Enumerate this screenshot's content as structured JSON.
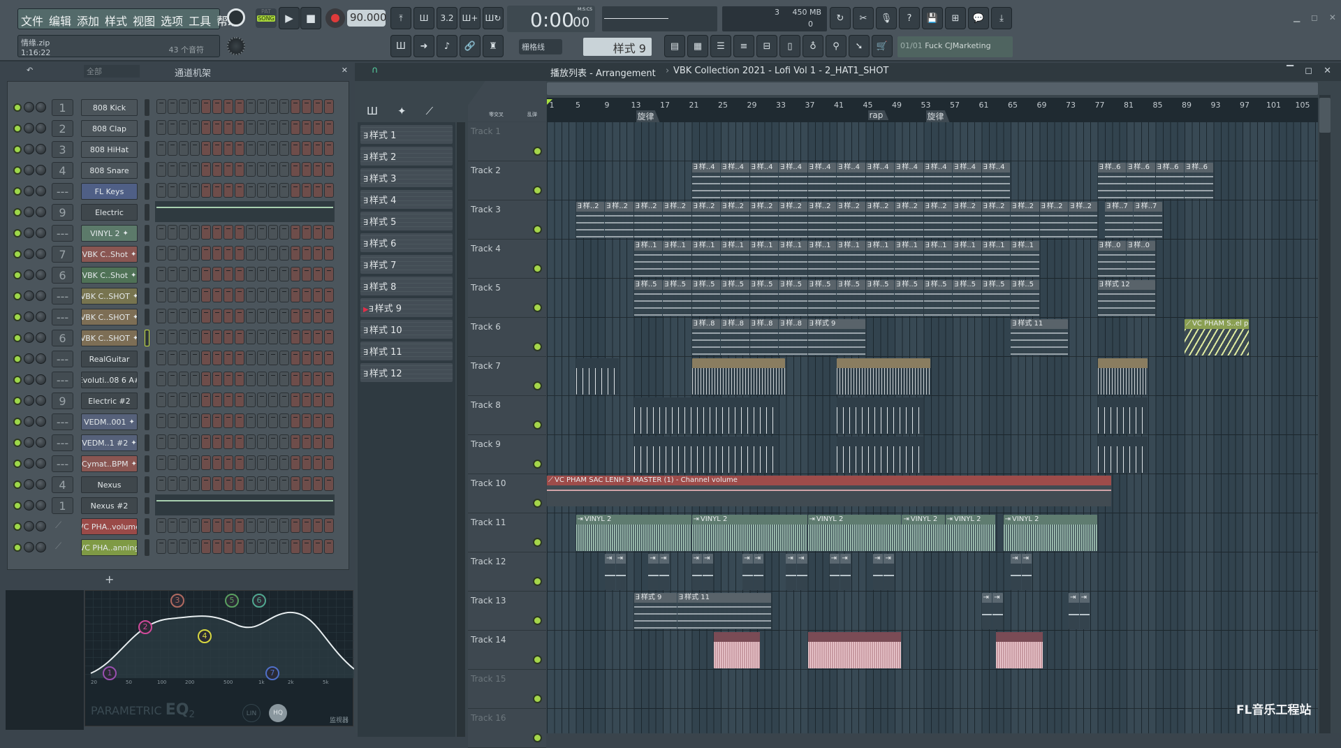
{
  "menu": [
    "文件",
    "编辑",
    "添加",
    "样式",
    "视图",
    "选项",
    "工具",
    "帮助"
  ],
  "transport": {
    "pat": "PAT",
    "song": "SONG",
    "tempo": "90.000",
    "time": "0:00:00",
    "time_main": "0:00",
    "time_cs": "00",
    "time_format": "M:S:CS",
    "cpu": "3",
    "memory": "450 MB",
    "polyphony": "0"
  },
  "hint": {
    "file": "情缘.zip",
    "duration": "1:16:22",
    "notes": "43 个音符"
  },
  "snap": "栅格线",
  "pattern_selector": "样式 9",
  "news": {
    "counter": "01/01",
    "text": "Fuck CJMarketing"
  },
  "channel_rack": {
    "filter": "全部",
    "title": "通道机架",
    "add": "+",
    "channels": [
      {
        "num": "1",
        "name": "808 Kick",
        "color": "#4b545a",
        "mode": "steps"
      },
      {
        "num": "2",
        "name": "808 Clap",
        "color": "#4b545a",
        "mode": "steps"
      },
      {
        "num": "3",
        "name": "808 HiHat",
        "color": "#4b545a",
        "mode": "steps"
      },
      {
        "num": "4",
        "name": "808 Snare",
        "color": "#4b545a",
        "mode": "steps"
      },
      {
        "num": "---",
        "name": "FL Keys",
        "color": "#4f5f86",
        "mode": "steps"
      },
      {
        "num": "9",
        "name": "Electric",
        "color": "#3f474c",
        "mode": "graph"
      },
      {
        "num": "---",
        "name": "VINYL 2",
        "color": "#5c7a6a",
        "mode": "steps",
        "audio": true
      },
      {
        "num": "7",
        "name": "VBK C..Shot",
        "color": "#8a5652",
        "mode": "steps",
        "audio": true
      },
      {
        "num": "6",
        "name": "VBK C..Shot",
        "color": "#4f7256",
        "mode": "steps",
        "audio": true
      },
      {
        "num": "---",
        "name": "VBK C..SHOT",
        "color": "#77744f",
        "mode": "steps",
        "audio": true
      },
      {
        "num": "---",
        "name": "VBK C..SHOT",
        "color": "#7d6e55",
        "mode": "steps",
        "audio": true
      },
      {
        "num": "6",
        "name": "VBK C..SHOT",
        "color": "#7d6e55",
        "mode": "steps",
        "audio": true,
        "selected": true
      },
      {
        "num": "---",
        "name": "RealGuitar",
        "color": "#3f474c",
        "mode": "steps"
      },
      {
        "num": "---",
        "name": "Evoluti..08 6 A#",
        "color": "#3f474c",
        "mode": "steps"
      },
      {
        "num": "9",
        "name": "Electric #2",
        "color": "#3f474c",
        "mode": "steps"
      },
      {
        "num": "---",
        "name": "VEDM..001",
        "color": "#56617a",
        "mode": "steps",
        "audio": true
      },
      {
        "num": "---",
        "name": "VEDM..1 #2",
        "color": "#56617a",
        "mode": "steps",
        "audio": true
      },
      {
        "num": "---",
        "name": "Cymat..BPM",
        "color": "#8a5652",
        "mode": "steps",
        "audio": true
      },
      {
        "num": "4",
        "name": "Nexus",
        "color": "#3f474c",
        "mode": "steps"
      },
      {
        "num": "1",
        "name": "Nexus #2",
        "color": "#3f474c",
        "mode": "graph"
      },
      {
        "num": "",
        "name": "VC PHA..volume",
        "color": "#9a4a48",
        "mode": "steps",
        "automation": true
      },
      {
        "num": "",
        "name": "VC PHA..anning",
        "color": "#7f9a45",
        "mode": "steps",
        "automation": true
      }
    ]
  },
  "eq": {
    "title": "PARAMETRIC",
    "title_big": "EQ",
    "title_sub": "2",
    "freqs": [
      "20",
      "50",
      "100",
      "200",
      "500",
      "1k",
      "2k",
      "5k"
    ],
    "bands": [
      "1",
      "2",
      "3",
      "4",
      "5",
      "6",
      "7"
    ],
    "band_colors": [
      "#9a4fb0",
      "#d04a9a",
      "#b06a60",
      "#d8d840",
      "#5aa060",
      "#50a890",
      "#4f70c8"
    ],
    "lin": "LIN",
    "hq": "HQ",
    "monitor": "监视器"
  },
  "playlist": {
    "title": "播放列表 - Arrangement",
    "breadcrumb": "VBK Collection 2021 - Lofi Vol 1 - 2_HAT1_SHOT",
    "toggle1": "零交叉",
    "toggle2": "乱弹",
    "patterns": [
      "样式 1",
      "样式 2",
      "样式 3",
      "样式 4",
      "样式 5",
      "样式 6",
      "样式 7",
      "样式 8",
      "样式 9",
      "样式 10",
      "样式 11",
      "样式 12"
    ],
    "current_pattern_index": 8,
    "bar_labels": [
      "1",
      "5",
      "9",
      "13",
      "17",
      "21",
      "25",
      "29",
      "33",
      "37",
      "41",
      "45",
      "49",
      "53",
      "57",
      "61",
      "65",
      "69",
      "73",
      "77",
      "81",
      "85",
      "89",
      "93",
      "97",
      "101",
      "105"
    ],
    "markers": [
      {
        "bar": 13,
        "label": "旋律"
      },
      {
        "bar": 45,
        "label": "rap"
      },
      {
        "bar": 53,
        "label": "旋律"
      }
    ],
    "tracks": [
      "Track 1",
      "Track 2",
      "Track 3",
      "Track 4",
      "Track 5",
      "Track 6",
      "Track 7",
      "Track 8",
      "Track 9",
      "Track 10",
      "Track 11",
      "Track 12",
      "Track 13",
      "Track 14",
      "Track 15",
      "Track 16"
    ],
    "clips": [
      {
        "track": 2,
        "start": 21,
        "len": 4,
        "repeat": 11,
        "label": "样..4",
        "type": "pattern"
      },
      {
        "track": 2,
        "start": 77,
        "len": 4,
        "repeat": 4,
        "label": "样..6",
        "type": "pattern"
      },
      {
        "track": 3,
        "start": 5,
        "len": 4,
        "repeat": 18,
        "label": "样..2",
        "type": "pattern"
      },
      {
        "track": 3,
        "start": 78,
        "len": 4,
        "repeat": 2,
        "label": "样..7",
        "type": "pattern"
      },
      {
        "track": 4,
        "start": 13,
        "len": 4,
        "repeat": 14,
        "label": "样..1",
        "type": "pattern"
      },
      {
        "track": 4,
        "start": 77,
        "len": 4,
        "repeat": 2,
        "label": "样..0",
        "type": "pattern"
      },
      {
        "track": 5,
        "start": 13,
        "len": 4,
        "repeat": 14,
        "label": "样..5",
        "type": "pattern"
      },
      {
        "track": 5,
        "start": 77,
        "len": 8,
        "repeat": 1,
        "label": "样式 12",
        "type": "pattern"
      },
      {
        "track": 6,
        "start": 21,
        "len": 4,
        "repeat": 4,
        "label": "样..8",
        "type": "pattern"
      },
      {
        "track": 6,
        "start": 37,
        "len": 8,
        "repeat": 1,
        "label": "样式 9",
        "type": "pattern"
      },
      {
        "track": 6,
        "start": 65,
        "len": 8,
        "repeat": 1,
        "label": "样式 11",
        "type": "pattern"
      },
      {
        "track": 6,
        "start": 89,
        "len": 9,
        "repeat": 1,
        "label": "VC PHAM S..el panning",
        "type": "auto-green"
      },
      {
        "track": 7,
        "start": 5,
        "len": 6,
        "repeat": 1,
        "label": "",
        "type": "hits"
      },
      {
        "track": 7,
        "start": 21,
        "len": 13,
        "repeat": 1,
        "label": "",
        "type": "tan"
      },
      {
        "track": 7,
        "start": 41,
        "len": 13,
        "repeat": 1,
        "label": "",
        "type": "tan"
      },
      {
        "track": 7,
        "start": 77,
        "len": 7,
        "repeat": 1,
        "label": "",
        "type": "tan"
      },
      {
        "track": 8,
        "start": 13,
        "len": 20,
        "repeat": 1,
        "label": "",
        "type": "hits"
      },
      {
        "track": 8,
        "start": 41,
        "len": 12,
        "repeat": 1,
        "label": "",
        "type": "hits"
      },
      {
        "track": 8,
        "start": 77,
        "len": 7,
        "repeat": 1,
        "label": "",
        "type": "hits"
      },
      {
        "track": 9,
        "start": 13,
        "len": 20,
        "repeat": 1,
        "label": "",
        "type": "hits"
      },
      {
        "track": 9,
        "start": 41,
        "len": 12,
        "repeat": 1,
        "label": "",
        "type": "hits"
      },
      {
        "track": 9,
        "start": 77,
        "len": 7,
        "repeat": 1,
        "label": "",
        "type": "hits"
      },
      {
        "track": 10,
        "start": 1,
        "len": 78,
        "repeat": 1,
        "label": "VC PHAM SAC LENH 3 MASTER (1) - Channel volume",
        "type": "auto-red"
      },
      {
        "track": 11,
        "start": 5,
        "len": 16,
        "repeat": 1,
        "label": "VINYL 2",
        "type": "vinyl"
      },
      {
        "track": 11,
        "start": 21,
        "len": 16,
        "repeat": 1,
        "label": "VINYL 2",
        "type": "vinyl"
      },
      {
        "track": 11,
        "start": 37,
        "len": 13,
        "repeat": 1,
        "label": "VINYL 2",
        "type": "vinyl"
      },
      {
        "track": 11,
        "start": 50,
        "len": 6,
        "repeat": 1,
        "label": "VINYL 2",
        "type": "vinyl"
      },
      {
        "track": 11,
        "start": 56,
        "len": 7,
        "repeat": 1,
        "label": "VINYL 2",
        "type": "vinyl"
      },
      {
        "track": 11,
        "start": 64,
        "len": 13,
        "repeat": 1,
        "label": "VINYL 2",
        "type": "vinyl"
      },
      {
        "track": 12,
        "start": 9,
        "len": 1.5,
        "repeat": 2,
        "label": "",
        "type": "fx"
      },
      {
        "track": 12,
        "start": 15,
        "len": 1.5,
        "repeat": 2,
        "label": "",
        "type": "fx"
      },
      {
        "track": 12,
        "start": 21,
        "len": 1.5,
        "repeat": 2,
        "label": "",
        "type": "fx"
      },
      {
        "track": 12,
        "start": 28,
        "len": 1.5,
        "repeat": 2,
        "label": "",
        "type": "fx"
      },
      {
        "track": 12,
        "start": 34,
        "len": 1.5,
        "repeat": 2,
        "label": "",
        "type": "fx"
      },
      {
        "track": 12,
        "start": 40,
        "len": 1.5,
        "repeat": 2,
        "label": "",
        "type": "fx"
      },
      {
        "track": 12,
        "start": 46,
        "len": 1.5,
        "repeat": 2,
        "label": "",
        "type": "fx"
      },
      {
        "track": 12,
        "start": 65,
        "len": 1.5,
        "repeat": 2,
        "label": "",
        "type": "fx"
      },
      {
        "track": 13,
        "start": 13,
        "len": 6,
        "repeat": 1,
        "label": "样式 9",
        "type": "pattern"
      },
      {
        "track": 13,
        "start": 19,
        "len": 13,
        "repeat": 1,
        "label": "样式 11",
        "type": "pattern"
      },
      {
        "track": 13,
        "start": 61,
        "len": 1.5,
        "repeat": 2,
        "label": "",
        "type": "fx"
      },
      {
        "track": 13,
        "start": 73,
        "len": 1.5,
        "repeat": 2,
        "label": "",
        "type": "fx"
      },
      {
        "track": 14,
        "start": 24,
        "len": 6.5,
        "repeat": 1,
        "label": "",
        "type": "pink"
      },
      {
        "track": 14,
        "start": 37,
        "len": 13,
        "repeat": 1,
        "label": "",
        "type": "pink"
      },
      {
        "track": 14,
        "start": 63,
        "len": 6.5,
        "repeat": 1,
        "label": "",
        "type": "pink"
      }
    ]
  },
  "watermark": "FL音乐工程站"
}
